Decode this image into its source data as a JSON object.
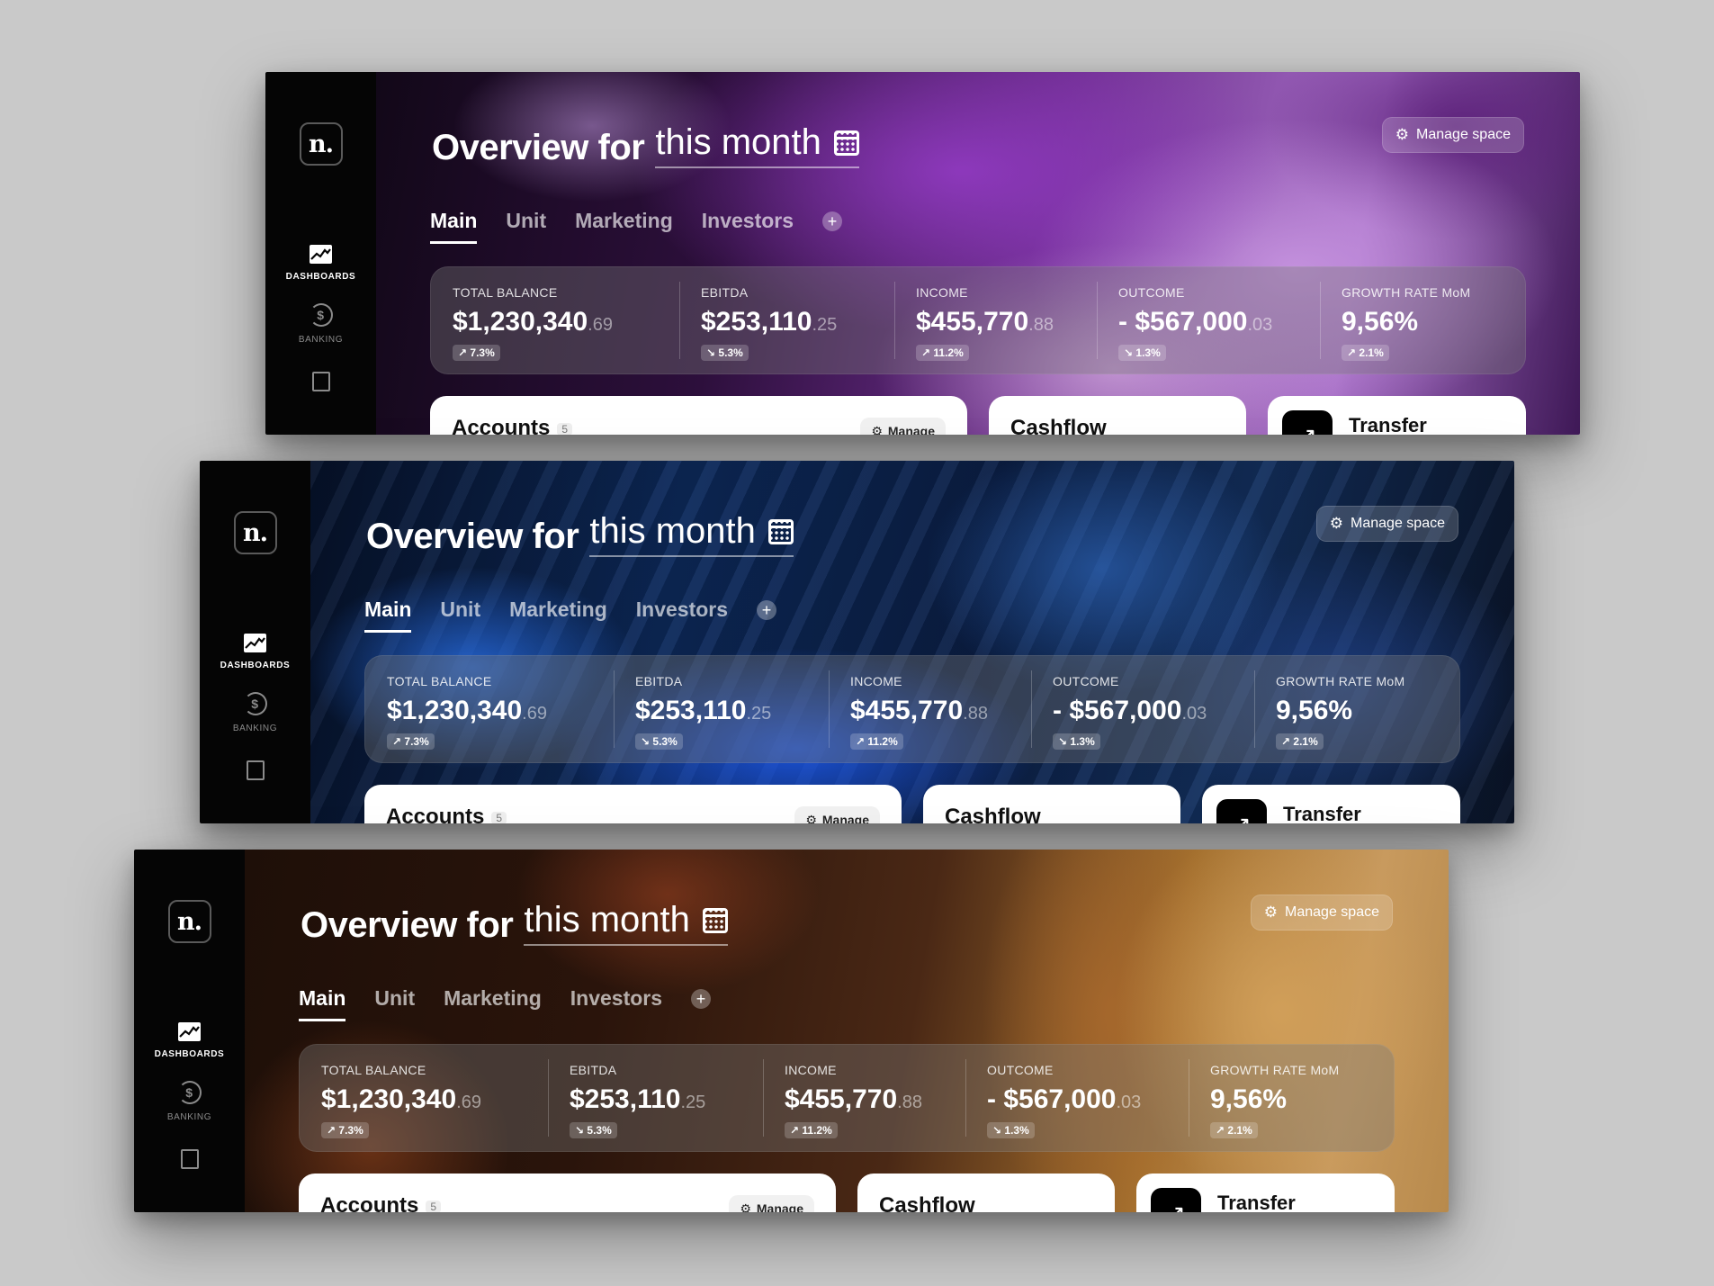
{
  "panels": [
    {
      "theme": "purple",
      "sidebar": {
        "logo": "n.",
        "nav": [
          {
            "label": "DASHBOARDS",
            "icon": "chart-icon",
            "active": true
          },
          {
            "label": "BANKING",
            "icon": "dollar-cycle-icon",
            "active": false
          },
          {
            "label": "",
            "icon": "document-icon",
            "active": false
          }
        ]
      },
      "header": {
        "title_bold": "Overview for",
        "title_period": "this month",
        "manage_label": "Manage space"
      },
      "tabs": [
        "Main",
        "Unit",
        "Marketing",
        "Investors"
      ],
      "active_tab": "Main",
      "stats": [
        {
          "label": "TOTAL BALANCE",
          "value": "$1,230,340",
          "decimal": ".69",
          "change": "7.3%",
          "trend": "up"
        },
        {
          "label": "EBITDA",
          "value": "$253,110",
          "decimal": ".25",
          "change": "5.3%",
          "trend": "down"
        },
        {
          "label": "INCOME",
          "value": "$455,770",
          "decimal": ".88",
          "change": "11.2%",
          "trend": "up"
        },
        {
          "label": "OUTCOME",
          "value": "- $567,000",
          "decimal": ".03",
          "change": "1.3%",
          "trend": "down"
        },
        {
          "label": "GROWTH RATE MoM",
          "value": "9,56%",
          "decimal": "",
          "change": "2.1%",
          "trend": "up"
        }
      ],
      "cards": {
        "accounts": {
          "title": "Accounts",
          "count": "5",
          "manage": "Manage"
        },
        "cashflow": {
          "title": "Cashflow"
        },
        "transfer": {
          "title": "Transfer"
        }
      }
    },
    {
      "theme": "blue",
      "sidebar": {
        "logo": "n.",
        "nav": [
          {
            "label": "DASHBOARDS",
            "icon": "chart-icon",
            "active": true
          },
          {
            "label": "BANKING",
            "icon": "dollar-cycle-icon",
            "active": false
          },
          {
            "label": "",
            "icon": "document-icon",
            "active": false
          }
        ]
      },
      "header": {
        "title_bold": "Overview for",
        "title_period": "this month",
        "manage_label": "Manage space"
      },
      "tabs": [
        "Main",
        "Unit",
        "Marketing",
        "Investors"
      ],
      "active_tab": "Main",
      "stats": [
        {
          "label": "TOTAL BALANCE",
          "value": "$1,230,340",
          "decimal": ".69",
          "change": "7.3%",
          "trend": "up"
        },
        {
          "label": "EBITDA",
          "value": "$253,110",
          "decimal": ".25",
          "change": "5.3%",
          "trend": "down"
        },
        {
          "label": "INCOME",
          "value": "$455,770",
          "decimal": ".88",
          "change": "11.2%",
          "trend": "up"
        },
        {
          "label": "OUTCOME",
          "value": "- $567,000",
          "decimal": ".03",
          "change": "1.3%",
          "trend": "down"
        },
        {
          "label": "GROWTH RATE MoM",
          "value": "9,56%",
          "decimal": "",
          "change": "2.1%",
          "trend": "up"
        }
      ],
      "cards": {
        "accounts": {
          "title": "Accounts",
          "count": "5",
          "manage": "Manage"
        },
        "cashflow": {
          "title": "Cashflow"
        },
        "transfer": {
          "title": "Transfer"
        }
      }
    },
    {
      "theme": "amber",
      "sidebar": {
        "logo": "n.",
        "nav": [
          {
            "label": "DASHBOARDS",
            "icon": "chart-icon",
            "active": true
          },
          {
            "label": "BANKING",
            "icon": "dollar-cycle-icon",
            "active": false
          },
          {
            "label": "",
            "icon": "document-icon",
            "active": false
          }
        ]
      },
      "header": {
        "title_bold": "Overview for",
        "title_period": "this month",
        "manage_label": "Manage space"
      },
      "tabs": [
        "Main",
        "Unit",
        "Marketing",
        "Investors"
      ],
      "active_tab": "Main",
      "stats": [
        {
          "label": "TOTAL BALANCE",
          "value": "$1,230,340",
          "decimal": ".69",
          "change": "7.3%",
          "trend": "up"
        },
        {
          "label": "EBITDA",
          "value": "$253,110",
          "decimal": ".25",
          "change": "5.3%",
          "trend": "down"
        },
        {
          "label": "INCOME",
          "value": "$455,770",
          "decimal": ".88",
          "change": "11.2%",
          "trend": "up"
        },
        {
          "label": "OUTCOME",
          "value": "- $567,000",
          "decimal": ".03",
          "change": "1.3%",
          "trend": "down"
        },
        {
          "label": "GROWTH RATE MoM",
          "value": "9,56%",
          "decimal": "",
          "change": "2.1%",
          "trend": "up"
        }
      ],
      "cards": {
        "accounts": {
          "title": "Accounts",
          "count": "5",
          "manage": "Manage"
        },
        "cashflow": {
          "title": "Cashflow"
        },
        "transfer": {
          "title": "Transfer"
        }
      }
    }
  ],
  "icons": {
    "up": "↗",
    "down": "↘",
    "gear": "⚙",
    "plus": "+",
    "arrow": "↗"
  },
  "colors": {
    "page_bg": "#c9c9c9",
    "sidebar_bg": "#050505",
    "card_bg": "#ffffff"
  }
}
